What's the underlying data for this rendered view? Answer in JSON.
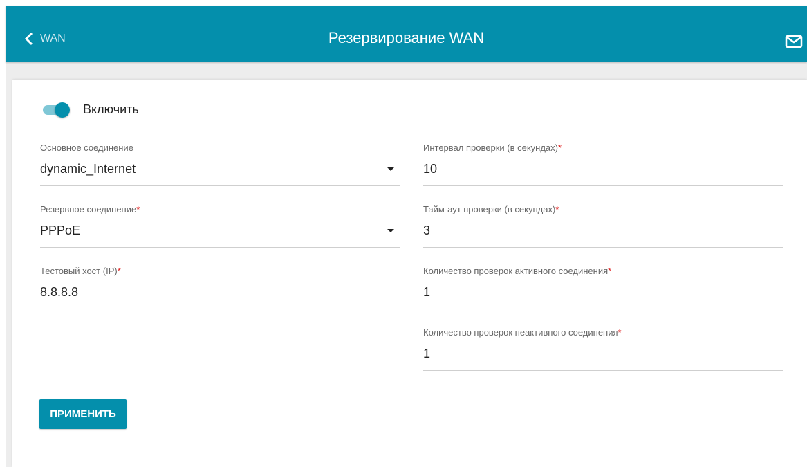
{
  "header": {
    "back_label": "WAN",
    "title": "Резервирование WAN",
    "back_icon": "chevron-left-icon",
    "mail_icon": "mail-icon"
  },
  "form": {
    "enable_label": "Включить",
    "enable_on": true,
    "primary": {
      "label": "Основное соединение",
      "value": "dynamic_Internet"
    },
    "backup": {
      "label": "Резервное соединение",
      "value": "PPPoE"
    },
    "test_host": {
      "label": "Тестовый хост (IP)",
      "value": "8.8.8.8"
    },
    "interval": {
      "label": "Интервал проверки (в секундах)",
      "value": "10"
    },
    "timeout": {
      "label": "Тайм-аут проверки (в секундах)",
      "value": "3"
    },
    "active_checks": {
      "label": "Количество проверок активного соединения",
      "value": "1"
    },
    "inactive_checks": {
      "label": "Количество проверок неактивного соединения",
      "value": "1"
    },
    "required_mark": "*",
    "apply_label": "ПРИМЕНИТЬ"
  },
  "colors": {
    "accent": "#048fac",
    "required": "#e02222"
  }
}
